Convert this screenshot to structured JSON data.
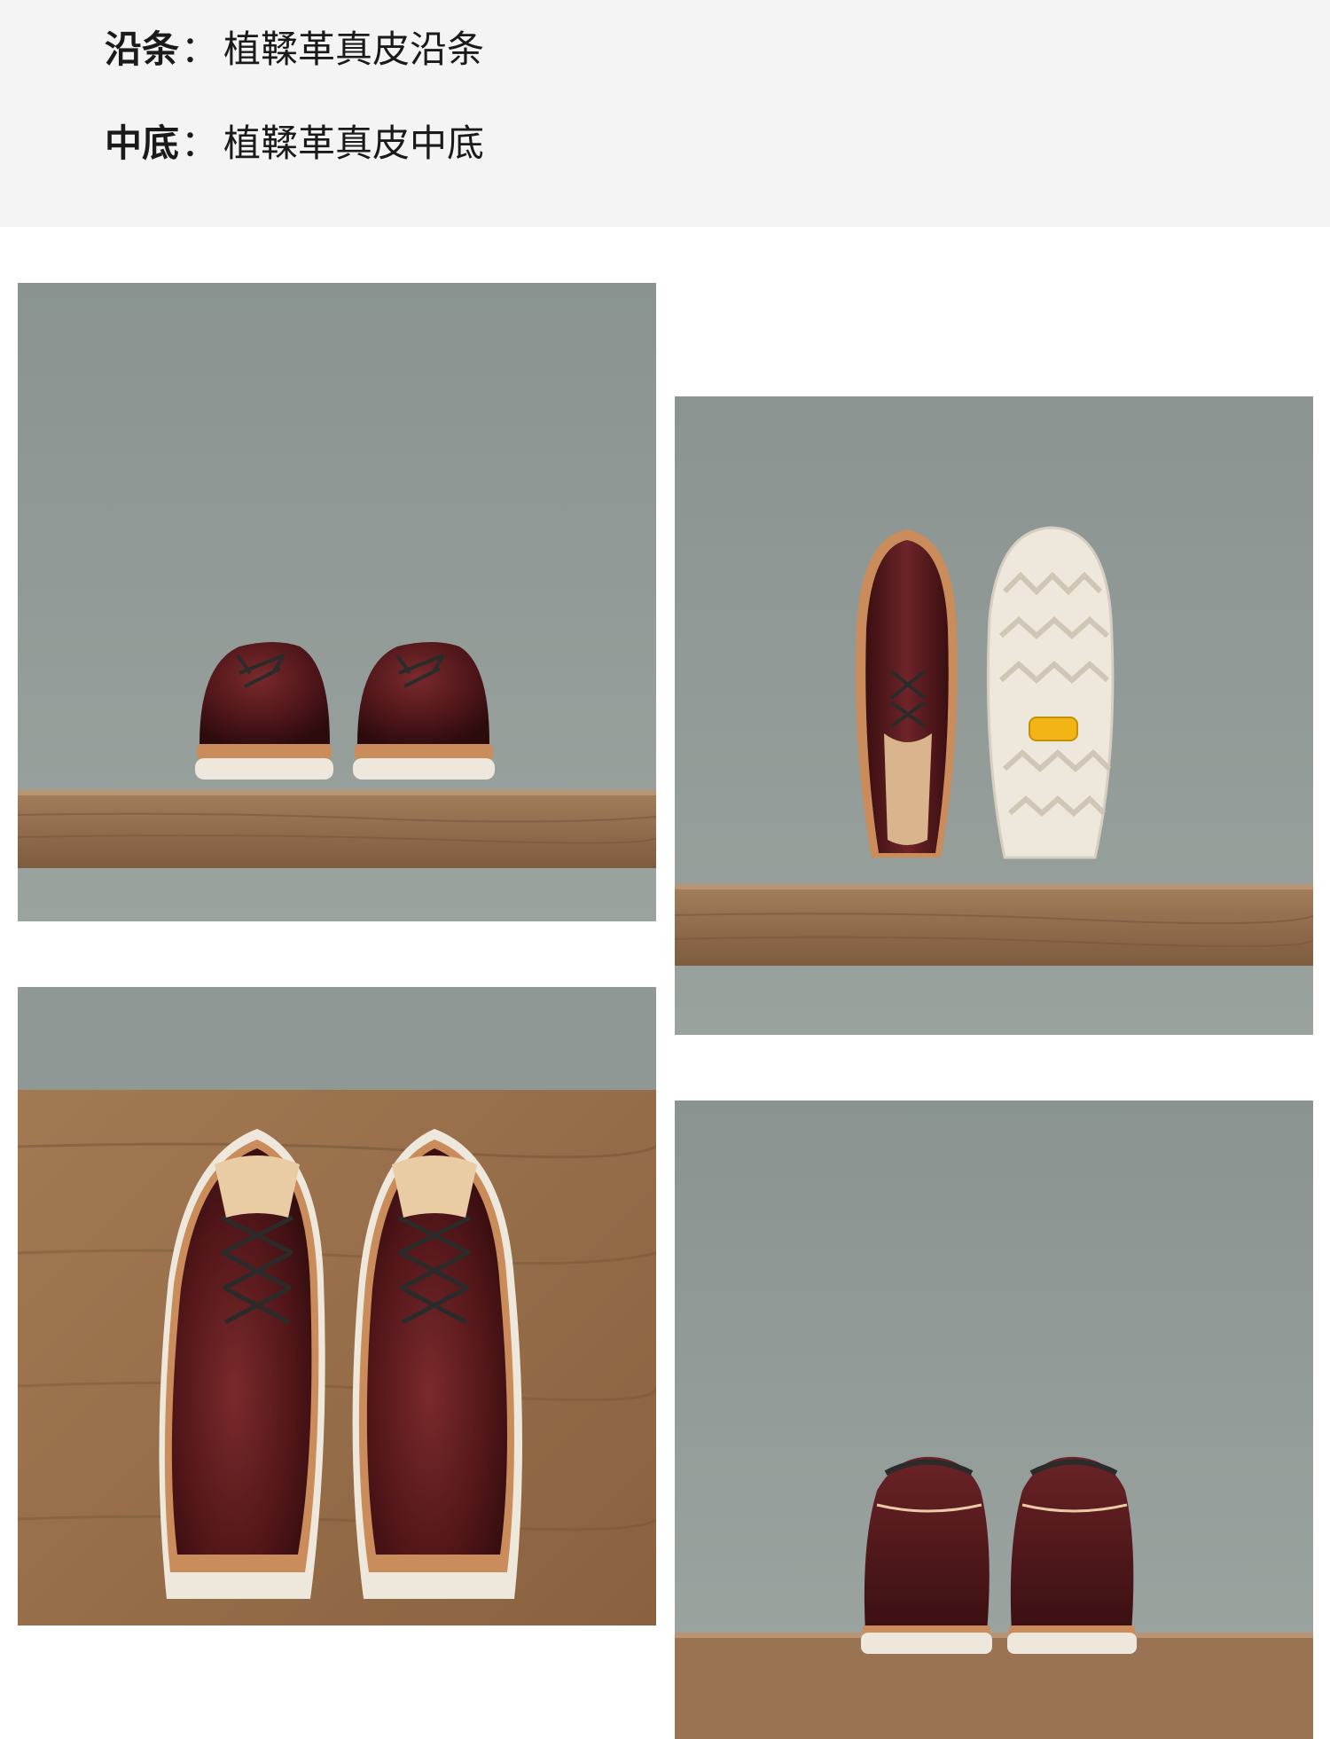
{
  "specs": [
    {
      "label": "沿条",
      "separator": "：",
      "value": "植鞣革真皮沿条"
    },
    {
      "label": "中底",
      "separator": "：",
      "value": "植鞣革真皮中底"
    }
  ],
  "photos": [
    {
      "subject": "front view of pair of burgundy moc-toe oxford shoes on wooden shelf"
    },
    {
      "subject": "side view of shoe beside white lug outsole with yellow logo badge"
    },
    {
      "subject": "top-down view of pair of burgundy oxford shoes on wooden surface"
    },
    {
      "subject": "rear view of pair of burgundy oxford shoes on wooden shelf"
    }
  ],
  "colors": {
    "panel_bg": "#f4f4f4",
    "backdrop": "#8f9894",
    "leather": "#5a1a1e",
    "wood": "#9a7352",
    "sole": "#eee8dc",
    "badge": "#f2b515"
  }
}
